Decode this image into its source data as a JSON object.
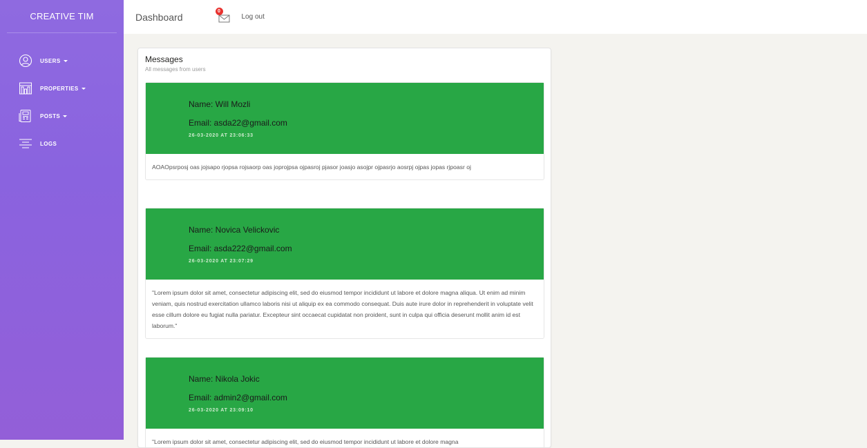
{
  "brand": "CREATIVE TIM",
  "sidebar": {
    "items": [
      {
        "label": "USERS",
        "icon": "user-circle-icon",
        "has_caret": true
      },
      {
        "label": "PROPERTIES",
        "icon": "building-icon",
        "has_caret": true
      },
      {
        "label": "POSTS",
        "icon": "newspaper-icon",
        "has_caret": true
      },
      {
        "label": "LOGS",
        "icon": "align-center-icon",
        "has_caret": false
      }
    ]
  },
  "topbar": {
    "title": "Dashboard",
    "notification_count": "0",
    "notification_icon": "envelope-icon",
    "logout_label": "Log out"
  },
  "messages_card": {
    "title": "Messages",
    "subtitle": "All messages from users",
    "messages": [
      {
        "name": "Name: Will Mozli",
        "email": "Email: asda22@gmail.com",
        "date": "26-03-2020 AT 23:06:33",
        "body": "AOAOpsrposj oas jojsapo rjopsa rojsaorp oas joprojpsa ojpasroj pjasor joasjo asojpr ojpasrjo aosrpj ojpas jopas rjpoasr oj"
      },
      {
        "name": "Name: Novica Velickovic",
        "email": "Email: asda222@gmail.com",
        "date": "26-03-2020 AT 23:07:29",
        "body": "\"Lorem ipsum dolor sit amet, consectetur adipiscing elit, sed do eiusmod tempor incididunt ut labore et dolore magna aliqua. Ut enim ad minim veniam, quis nostrud exercitation ullamco laboris nisi ut aliquip ex ea commodo consequat. Duis aute irure dolor in reprehenderit in voluptate velit esse cillum dolore eu fugiat nulla pariatur. Excepteur sint occaecat cupidatat non proident, sunt in culpa qui officia deserunt mollit anim id est laborum.\""
      },
      {
        "name": "Name: Nikola Jokic",
        "email": "Email: admin2@gmail.com",
        "date": "26-03-2020 AT 23:09:10",
        "body": "\"Lorem ipsum dolor sit amet, consectetur adipiscing elit, sed do eiusmod tempor incididunt ut labore et dolore magna"
      }
    ]
  },
  "colors": {
    "sidebar": "#8d65df",
    "message_header": "#28a745",
    "badge": "#e8322f"
  }
}
